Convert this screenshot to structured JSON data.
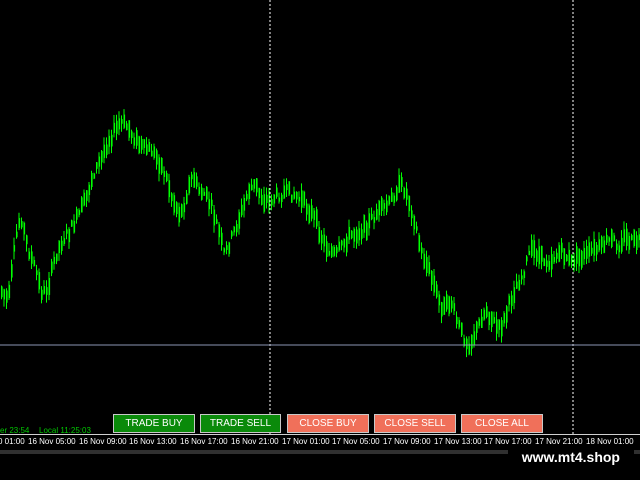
{
  "status": {
    "server_time": "er 23:54",
    "local_time": "Local 11:25:03"
  },
  "buttons": [
    {
      "label": "TRADE BUY",
      "style": "green"
    },
    {
      "label": "TRADE SELL",
      "style": "green"
    },
    {
      "label": "CLOSE BUY",
      "style": "red"
    },
    {
      "label": "CLOSE SELL",
      "style": "red"
    },
    {
      "label": "CLOSE ALL",
      "style": "red"
    }
  ],
  "time_axis": [
    "0 01:00",
    "16 Nov 05:00",
    "16 Nov 09:00",
    "16 Nov 13:00",
    "16 Nov 17:00",
    "16 Nov 21:00",
    "17 Nov 01:00",
    "17 Nov 05:00",
    "17 Nov 09:00",
    "17 Nov 13:00",
    "17 Nov 17:00",
    "17 Nov 21:00",
    "18 Nov 01:00"
  ],
  "watermark": "www.mt4.shop",
  "colors": {
    "background": "#000000",
    "candles": "#00ff00",
    "separator": "#ffffff",
    "bid_line": "#8c96b4",
    "buy_button": "#0a8a0a",
    "sell_close_button": "#f0705a"
  }
}
